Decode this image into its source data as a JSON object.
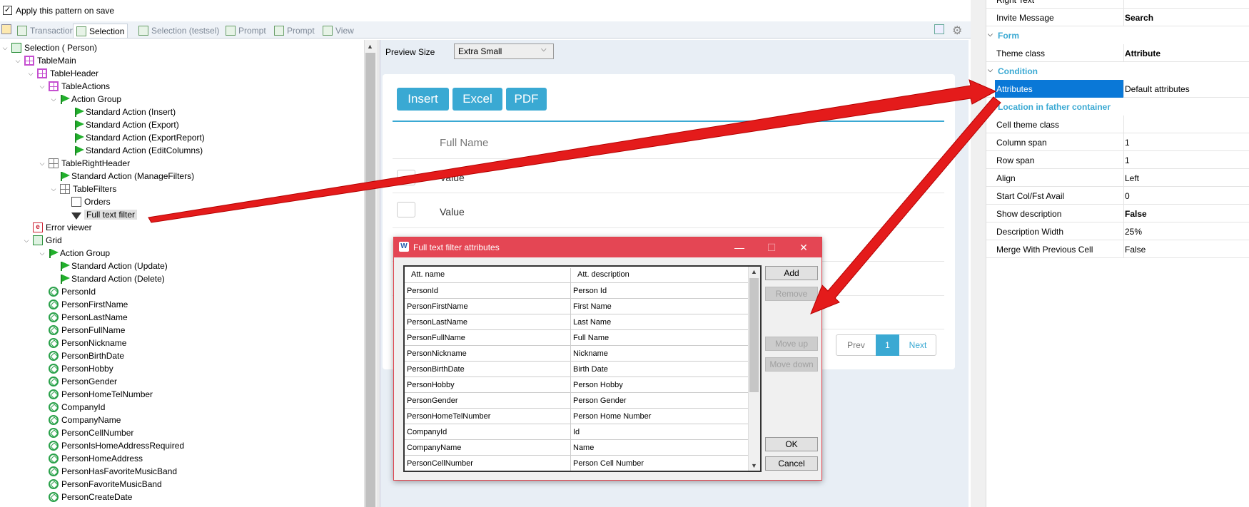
{
  "topbar": {
    "apply_checkbox_label": "Apply this pattern on save",
    "apply_checked_mark": "✓"
  },
  "tabs": [
    {
      "label": "Transaction",
      "active": false
    },
    {
      "label": "Selection",
      "active": true
    },
    {
      "label": "Selection (testsel)",
      "active": false
    },
    {
      "label": "Prompt",
      "active": false
    },
    {
      "label": "Prompt",
      "active": false
    },
    {
      "label": "View",
      "active": false
    }
  ],
  "tree": {
    "nodes": [
      {
        "label": "Selection ( Person)",
        "icon": "selection-icon"
      },
      {
        "label": "TableMain",
        "icon": "table-icon"
      },
      {
        "label": "TableHeader",
        "icon": "table-icon"
      },
      {
        "label": "TableActions",
        "icon": "table-icon"
      },
      {
        "label": "Action Group",
        "icon": "flag-icon"
      },
      {
        "label": "Standard Action (Insert)",
        "icon": "flag-icon"
      },
      {
        "label": "Standard Action (Export)",
        "icon": "flag-icon"
      },
      {
        "label": "Standard Action (ExportReport)",
        "icon": "flag-icon"
      },
      {
        "label": "Standard Action (EditColumns)",
        "icon": "flag-icon"
      },
      {
        "label": "TableRightHeader",
        "icon": "grid-table-icon"
      },
      {
        "label": "Standard Action (ManageFilters)",
        "icon": "flag-icon"
      },
      {
        "label": "TableFilters",
        "icon": "grid-table-icon"
      },
      {
        "label": "Orders",
        "icon": "orders-icon"
      },
      {
        "label": "Full text filter",
        "icon": "filter-icon"
      },
      {
        "label": "Error viewer",
        "icon": "error-viewer-icon"
      },
      {
        "label": "Grid",
        "icon": "selection-icon"
      },
      {
        "label": "Action Group",
        "icon": "flag-icon"
      },
      {
        "label": "Standard Action (Update)",
        "icon": "flag-icon"
      },
      {
        "label": "Standard Action (Delete)",
        "icon": "flag-icon"
      },
      {
        "label": "PersonId",
        "icon": "attribute-icon"
      },
      {
        "label": "PersonFirstName",
        "icon": "attribute-icon"
      },
      {
        "label": "PersonLastName",
        "icon": "attribute-icon"
      },
      {
        "label": "PersonFullName",
        "icon": "attribute-icon"
      },
      {
        "label": "PersonNickname",
        "icon": "attribute-icon"
      },
      {
        "label": "PersonBirthDate",
        "icon": "attribute-icon"
      },
      {
        "label": "PersonHobby",
        "icon": "attribute-icon"
      },
      {
        "label": "PersonGender",
        "icon": "attribute-icon"
      },
      {
        "label": "PersonHomeTelNumber",
        "icon": "attribute-icon"
      },
      {
        "label": "CompanyId",
        "icon": "attribute-icon"
      },
      {
        "label": "CompanyName",
        "icon": "attribute-icon"
      },
      {
        "label": "PersonCellNumber",
        "icon": "attribute-icon"
      },
      {
        "label": "PersonIsHomeAddressRequired",
        "icon": "attribute-icon"
      },
      {
        "label": "PersonHomeAddress",
        "icon": "attribute-icon"
      },
      {
        "label": "PersonHasFavoriteMusicBand",
        "icon": "attribute-icon"
      },
      {
        "label": "PersonFavoriteMusicBand",
        "icon": "attribute-icon"
      },
      {
        "label": "PersonCreateDate",
        "icon": "attribute-icon"
      }
    ]
  },
  "preview": {
    "size_label": "Preview Size",
    "size_value": "Extra Small",
    "buttons": [
      "Insert",
      "Excel",
      "PDF"
    ],
    "column_header": "Full Name",
    "row_values": [
      "Value",
      "Value"
    ],
    "pager": {
      "prev": "Prev",
      "page": "1",
      "next": "Next"
    }
  },
  "properties": {
    "rows": [
      {
        "type": "row",
        "key": "Right Text",
        "value": ""
      },
      {
        "type": "row",
        "key": "Invite Message",
        "value": "Search",
        "bold": true
      },
      {
        "type": "header",
        "key": "Form"
      },
      {
        "type": "row",
        "key": "Theme class",
        "value": "Attribute",
        "bold": true
      },
      {
        "type": "header",
        "key": "Condition"
      },
      {
        "type": "row",
        "key": "Attributes",
        "value": "Default attributes",
        "selected": true
      },
      {
        "type": "header",
        "key": "Location in father container"
      },
      {
        "type": "row",
        "key": "Cell theme class",
        "value": ""
      },
      {
        "type": "row",
        "key": "Column span",
        "value": "1"
      },
      {
        "type": "row",
        "key": "Row span",
        "value": "1"
      },
      {
        "type": "row",
        "key": "Align",
        "value": "Left"
      },
      {
        "type": "row",
        "key": "Start Col/Fst Avail",
        "value": "0"
      },
      {
        "type": "row",
        "key": "Show description",
        "value": "False",
        "bold": true
      },
      {
        "type": "row",
        "key": "Description Width",
        "value": "25%"
      },
      {
        "type": "row",
        "key": "Merge With Previous Cell",
        "value": "False"
      }
    ]
  },
  "dialog": {
    "title": "Full text filter attributes",
    "window_buttons": [
      "—",
      "☐",
      "✕"
    ],
    "columns": [
      "Att. name",
      "Att. description"
    ],
    "rows": [
      [
        "PersonId",
        "Person Id"
      ],
      [
        "PersonFirstName",
        "First Name"
      ],
      [
        "PersonLastName",
        "Last Name"
      ],
      [
        "PersonFullName",
        "Full Name"
      ],
      [
        "PersonNickname",
        "Nickname"
      ],
      [
        "PersonBirthDate",
        "Birth Date"
      ],
      [
        "PersonHobby",
        "Person Hobby"
      ],
      [
        "PersonGender",
        "Person Gender"
      ],
      [
        "PersonHomeTelNumber",
        "Person Home Number"
      ],
      [
        "CompanyId",
        "Id"
      ],
      [
        "CompanyName",
        "Name"
      ],
      [
        "PersonCellNumber",
        "Person Cell Number"
      ]
    ],
    "buttons": {
      "add": "Add",
      "remove": "Remove",
      "move_up": "Move up",
      "move_down": "Move down",
      "ok": "OK",
      "cancel": "Cancel"
    }
  },
  "colors": {
    "accent": "#3aa9d3",
    "dialog_title": "#e44654",
    "selection": "#0a78d7",
    "arrow": "#e41b1b"
  }
}
